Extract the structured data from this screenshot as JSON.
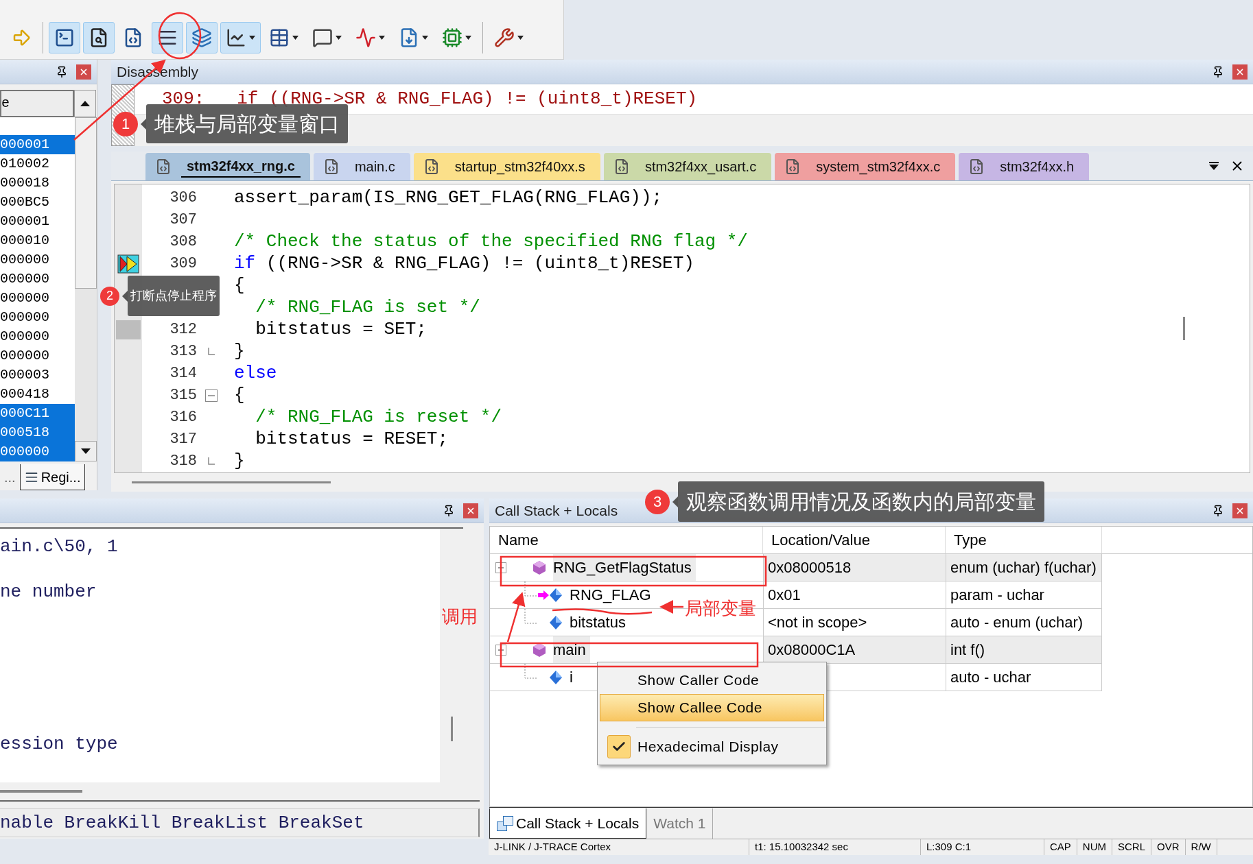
{
  "toolbar": {
    "groups": [
      [
        {
          "kind": "run-to",
          "selected": false,
          "dropdown": false
        }
      ],
      [
        {
          "kind": "command",
          "selected": true,
          "dropdown": false
        },
        {
          "kind": "disassembly",
          "selected": true,
          "dropdown": false
        },
        {
          "kind": "symbols",
          "selected": false,
          "dropdown": false
        },
        {
          "kind": "registers",
          "selected": true,
          "dropdown": false
        },
        {
          "kind": "call-stack",
          "selected": true,
          "dropdown": false
        },
        {
          "kind": "watch",
          "selected": true,
          "dropdown": true
        },
        {
          "kind": "memory",
          "selected": false,
          "dropdown": true
        },
        {
          "kind": "serial",
          "selected": false,
          "dropdown": true
        },
        {
          "kind": "analysis",
          "selected": false,
          "dropdown": true
        },
        {
          "kind": "trace",
          "selected": false,
          "dropdown": true
        },
        {
          "kind": "system-viewer",
          "selected": false,
          "dropdown": true
        }
      ],
      [
        {
          "kind": "toolbox",
          "selected": false,
          "dropdown": true
        }
      ]
    ]
  },
  "registers_panel": {
    "column_header": "e",
    "rows": [
      {
        "text": "000001",
        "selected": true
      },
      {
        "text": "010002",
        "selected": false
      },
      {
        "text": "000018",
        "selected": false
      },
      {
        "text": "000BC5",
        "selected": false
      },
      {
        "text": "000001",
        "selected": false
      },
      {
        "text": "000010",
        "selected": false
      },
      {
        "text": "000000",
        "selected": false
      },
      {
        "text": "000000",
        "selected": false
      },
      {
        "text": "000000",
        "selected": false
      },
      {
        "text": "000000",
        "selected": false
      },
      {
        "text": "000000",
        "selected": false
      },
      {
        "text": "000000",
        "selected": false
      },
      {
        "text": "000003",
        "selected": false
      },
      {
        "text": "000418",
        "selected": false
      },
      {
        "text": "000C11",
        "selected": true
      },
      {
        "text": "000518",
        "selected": true
      },
      {
        "text": "000000",
        "selected": true
      }
    ],
    "tabs": [
      {
        "label": "...",
        "selected": false
      },
      {
        "label": "Regi...",
        "selected": true
      }
    ]
  },
  "disassembly": {
    "title": "Disassembly",
    "line": "309:   if ((RNG->SR & RNG_FLAG) != (uint8_t)RESET)"
  },
  "editor": {
    "tabs": [
      {
        "label": "stm32f4xx_rng.c",
        "color": "#a9c3dc",
        "selected": true
      },
      {
        "label": "main.c",
        "color": "#c9d5ef",
        "selected": false
      },
      {
        "label": "startup_stm32f40xx.s",
        "color": "#fbe08a",
        "selected": false
      },
      {
        "label": "stm32f4xx_usart.c",
        "color": "#cbd9a8",
        "selected": false
      },
      {
        "label": "system_stm32f4xx.c",
        "color": "#ef9f9f",
        "selected": false
      },
      {
        "label": "stm32f4xx.h",
        "color": "#c6b6e4",
        "selected": false
      }
    ],
    "lines": [
      {
        "number": "306",
        "current": false,
        "executed": false,
        "fold_start": false,
        "fold_end": false,
        "segments": [
          {
            "kind": "plain",
            "text": "assert_param(IS_RNG_GET_FLAG(RNG_FLAG));"
          }
        ]
      },
      {
        "number": "307",
        "current": false,
        "executed": false,
        "fold_start": false,
        "fold_end": false
      },
      {
        "number": "308",
        "current": false,
        "executed": false,
        "fold_start": false,
        "fold_end": false,
        "segments": [
          {
            "kind": "comment",
            "text": "/* Check the status of the specified RNG flag */"
          }
        ]
      },
      {
        "number": "309",
        "current": true,
        "executed": false,
        "fold_start": false,
        "fold_end": false,
        "segments": [
          {
            "kind": "keyword",
            "text": "if"
          },
          {
            "kind": "plain",
            "text": " ((RNG->SR & RNG_FLAG) != (uint8_t)RESET)"
          }
        ]
      },
      {
        "segments": [
          {
            "kind": "plain",
            "text": "{"
          }
        ]
      },
      {
        "segments": [
          {
            "kind": "comment",
            "text": "  /* RNG_FLAG is set */"
          }
        ]
      },
      {
        "number": "312",
        "current": false,
        "executed": true,
        "fold_start": false,
        "fold_end": false,
        "segments": [
          {
            "kind": "plain",
            "text": "  bitstatus = SET;"
          }
        ]
      },
      {
        "number": "313",
        "current": false,
        "executed": false,
        "fold_start": false,
        "fold_end": true,
        "segments": [
          {
            "kind": "plain",
            "text": "}"
          }
        ]
      },
      {
        "number": "314",
        "current": false,
        "executed": false,
        "fold_start": false,
        "fold_end": false,
        "segments": [
          {
            "kind": "keyword",
            "text": "else"
          }
        ]
      },
      {
        "number": "315",
        "current": false,
        "executed": false,
        "fold_start": true,
        "fold_end": false,
        "segments": [
          {
            "kind": "plain",
            "text": "{"
          }
        ]
      },
      {
        "number": "316",
        "current": false,
        "executed": false,
        "fold_start": false,
        "fold_end": false,
        "segments": [
          {
            "kind": "comment",
            "text": "  /* RNG_FLAG is reset */"
          }
        ]
      },
      {
        "number": "317",
        "current": false,
        "executed": false,
        "fold_start": false,
        "fold_end": false,
        "segments": [
          {
            "kind": "plain",
            "text": "  bitstatus = RESET;"
          }
        ]
      },
      {
        "number": "318",
        "current": false,
        "executed": false,
        "fold_start": false,
        "fold_end": true,
        "segments": [
          {
            "kind": "plain",
            "text": "}"
          }
        ]
      }
    ]
  },
  "command_panel": {
    "lines": [
      "ain.c\\50, 1",
      "ne number",
      "ession type"
    ],
    "command_line": "nable BreakKill BreakList BreakSet"
  },
  "call_stack": {
    "title": "Call Stack + Locals",
    "columns": [
      "Name",
      "Location/Value",
      "Type"
    ],
    "tree": [
      {
        "name": "RNG_GetFlagStatus",
        "kind": "function",
        "expanded": true,
        "current": false,
        "value": "0x08000518",
        "type": "enum (uchar) f(uchar)",
        "children": [
          {
            "name": "RNG_FLAG",
            "kind": "variable",
            "current": true,
            "value": "0x01",
            "type": "param - uchar"
          },
          {
            "name": "bitstatus",
            "kind": "variable",
            "current": false,
            "value": "<not in scope>",
            "type": "auto - enum (uchar)"
          }
        ]
      },
      {
        "name": "main",
        "kind": "function",
        "expanded": true,
        "current": false,
        "value": "0x08000C1A",
        "type": "int f()",
        "children": [
          {
            "name": "i",
            "kind": "variable",
            "current": false,
            "type": "auto - uchar"
          }
        ]
      }
    ],
    "context_menu": [
      {
        "kind": "command",
        "label": "Show Caller Code",
        "highlighted": false
      },
      {
        "kind": "command",
        "label": "Show Callee Code",
        "highlighted": true
      },
      {
        "kind": "option",
        "label": "Hexadecimal Display",
        "highlighted": false,
        "checked": true
      }
    ],
    "tabs": [
      {
        "label": "Call Stack + Locals",
        "selected": true
      },
      {
        "label": "Watch 1",
        "selected": false
      }
    ]
  },
  "status_bar": [
    "J-LINK / J-TRACE Cortex",
    "t1: 15.10032342 sec",
    "L:309 C:1",
    "CAP",
    "NUM",
    "SCRL",
    "OVR",
    "R/W"
  ],
  "annotations": [
    {
      "number": "1",
      "text": "堆栈与局部变量窗口"
    },
    {
      "number": "2",
      "text": "打断点停止程序"
    },
    {
      "number": "3",
      "text": "观察函数调用情况及函数内的局部变量"
    }
  ],
  "notes": [
    "调用",
    "局部变量"
  ]
}
